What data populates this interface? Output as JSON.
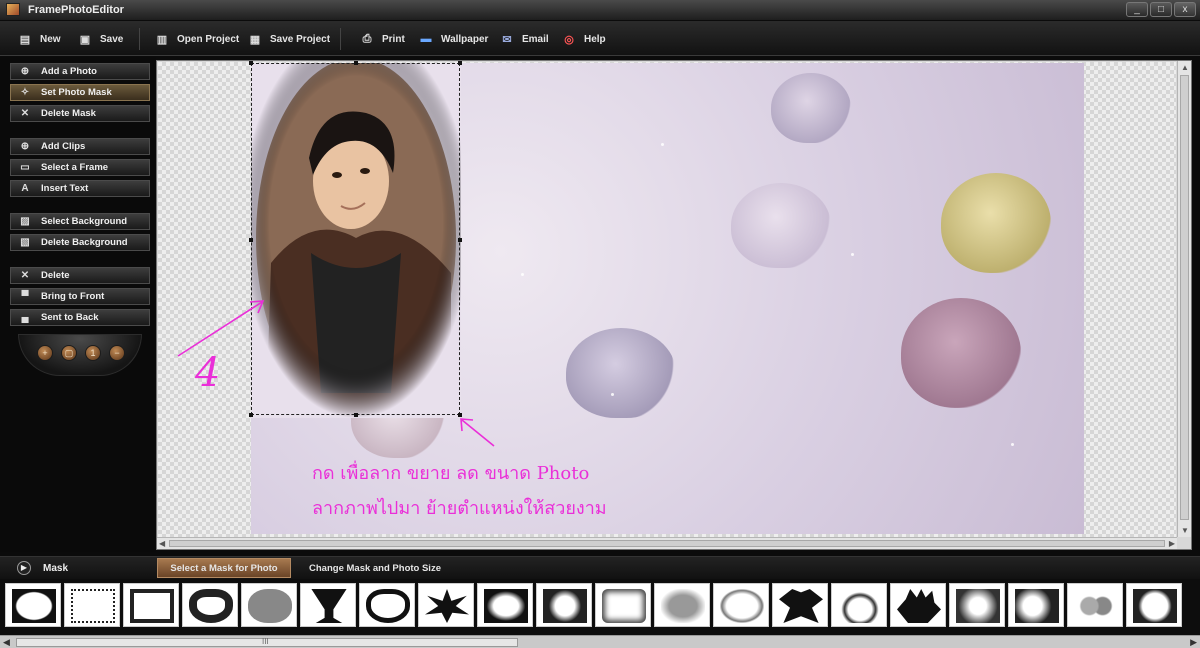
{
  "window": {
    "title": "FramePhotoEditor",
    "controls": [
      "_",
      "□",
      "x"
    ]
  },
  "toolbar": {
    "new": "New",
    "save": "Save",
    "open_project": "Open Project",
    "save_project": "Save Project",
    "print": "Print",
    "wallpaper": "Wallpaper",
    "email": "Email",
    "help": "Help"
  },
  "sidebar": {
    "items": [
      {
        "label": "Add a Photo",
        "icon": "add-photo-icon"
      },
      {
        "label": "Set Photo Mask",
        "icon": "photo-mask-icon",
        "active": true
      },
      {
        "label": "Delete Mask",
        "icon": "delete-mask-icon"
      },
      {
        "label": "Add Clips",
        "icon": "add-clips-icon"
      },
      {
        "label": "Select a Frame",
        "icon": "frame-icon"
      },
      {
        "label": "Insert Text",
        "icon": "text-icon"
      },
      {
        "label": "Select Background",
        "icon": "background-icon"
      },
      {
        "label": "Delete Background",
        "icon": "delete-background-icon"
      },
      {
        "label": "Delete",
        "icon": "x-icon"
      },
      {
        "label": "Bring to Front",
        "icon": "bring-front-icon"
      },
      {
        "label": "Sent to Back",
        "icon": "send-back-icon"
      }
    ],
    "dock_icons": [
      "zoom-in-icon",
      "fit-icon",
      "actual-size-icon",
      "zoom-out-icon"
    ]
  },
  "annotations": {
    "number": "4",
    "line1": "กด เพื่อลาก ขยาย ลด ขนาด Photo",
    "line2": "ลากภาพไปมา ย้ายตำแหน่งให้สวยงาม"
  },
  "mask_panel": {
    "title": "Mask",
    "tabs": {
      "active": "Select a Mask for Photo",
      "inactive": "Change Mask and Photo Size"
    },
    "masks": [
      "oval",
      "torn-rectangle",
      "stamp-rectangle",
      "heart",
      "cloud",
      "goblet",
      "heart-large",
      "starburst",
      "brush-stroke",
      "splash",
      "rounded-rectangle",
      "soft-oval",
      "oval-rough",
      "cherub",
      "swirl",
      "hand",
      "grunge-burst",
      "splatter",
      "hearts-pair",
      "grunge-edge"
    ]
  },
  "scrollbar": {
    "grip": "III"
  },
  "colors": {
    "annotation": "#ea2fd8",
    "active_tab": "#a7794f",
    "panel": "#0b0b0b"
  }
}
